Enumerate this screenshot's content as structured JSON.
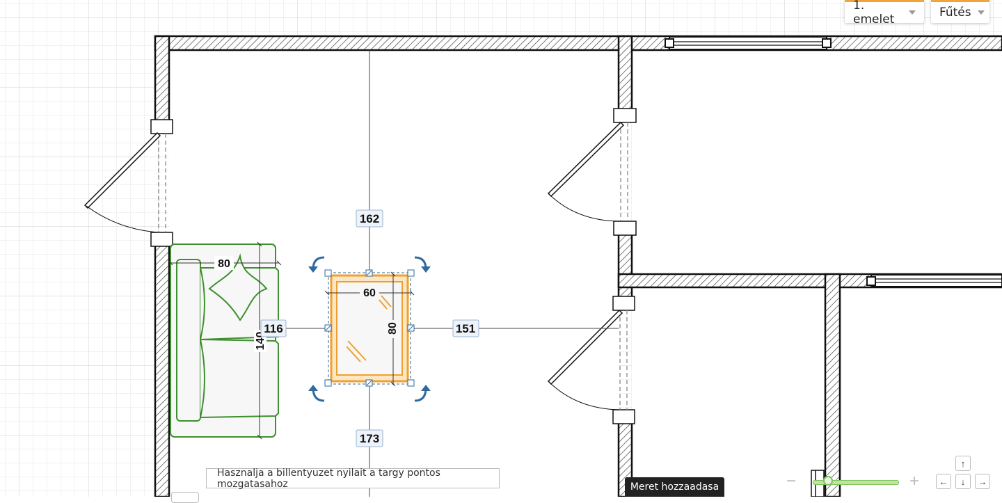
{
  "toolbar": {
    "floor_label": "1. emelet",
    "layer_label": "Fűtés"
  },
  "furniture": {
    "sofa_width": "80",
    "sofa_length": "140",
    "table_width": "60",
    "table_length": "80"
  },
  "distances": {
    "top": "162",
    "left": "116",
    "right": "151",
    "bottom": "173"
  },
  "hint_text": "Hasznalja a billentyuzet nyilait a targy pontos mozgatasahoz",
  "tooltip_text": "Meret hozzaadasa",
  "zoom": {
    "minus": "−",
    "plus": "+"
  },
  "nav_arrows": {
    "up": "↑",
    "left": "←",
    "down": "↓",
    "right": "→"
  },
  "colors": {
    "accent": "#f2a33a",
    "selected_item": "#f0a030",
    "furniture": "#3f8f2f",
    "handle": "#2e6a9e"
  }
}
